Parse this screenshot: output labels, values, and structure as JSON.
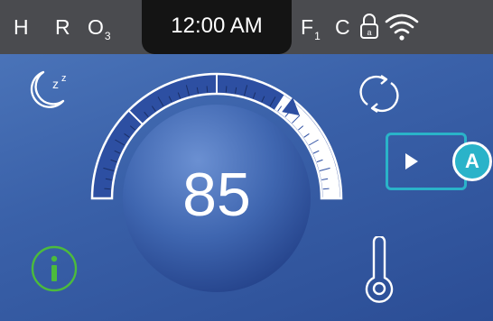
{
  "status_bar": {
    "h_label": "H",
    "r_label": "R",
    "o_label": "O",
    "o_sub": "3",
    "time": "12:00 AM",
    "f_label": "F",
    "f_sub": "1",
    "c_label": "C",
    "lock_icon": "lock-icon",
    "wifi_icon": "wifi-icon"
  },
  "thermostat": {
    "temperature": "85",
    "sleep_icon": "moon-sleep-icon",
    "cycle_icon": "refresh-cycle-icon",
    "info_icon": "info-icon",
    "thermometer_icon": "thermometer-icon",
    "play_icon": "play-icon"
  },
  "callout": {
    "label": "A"
  },
  "colors": {
    "status_bar": "#4a4b4f",
    "clock_bg": "#141414",
    "panel": "#3a61a9",
    "dial_fill": "#2e50a0",
    "info_green": "#4cbb3c",
    "callout_teal": "#2ab3c9"
  }
}
